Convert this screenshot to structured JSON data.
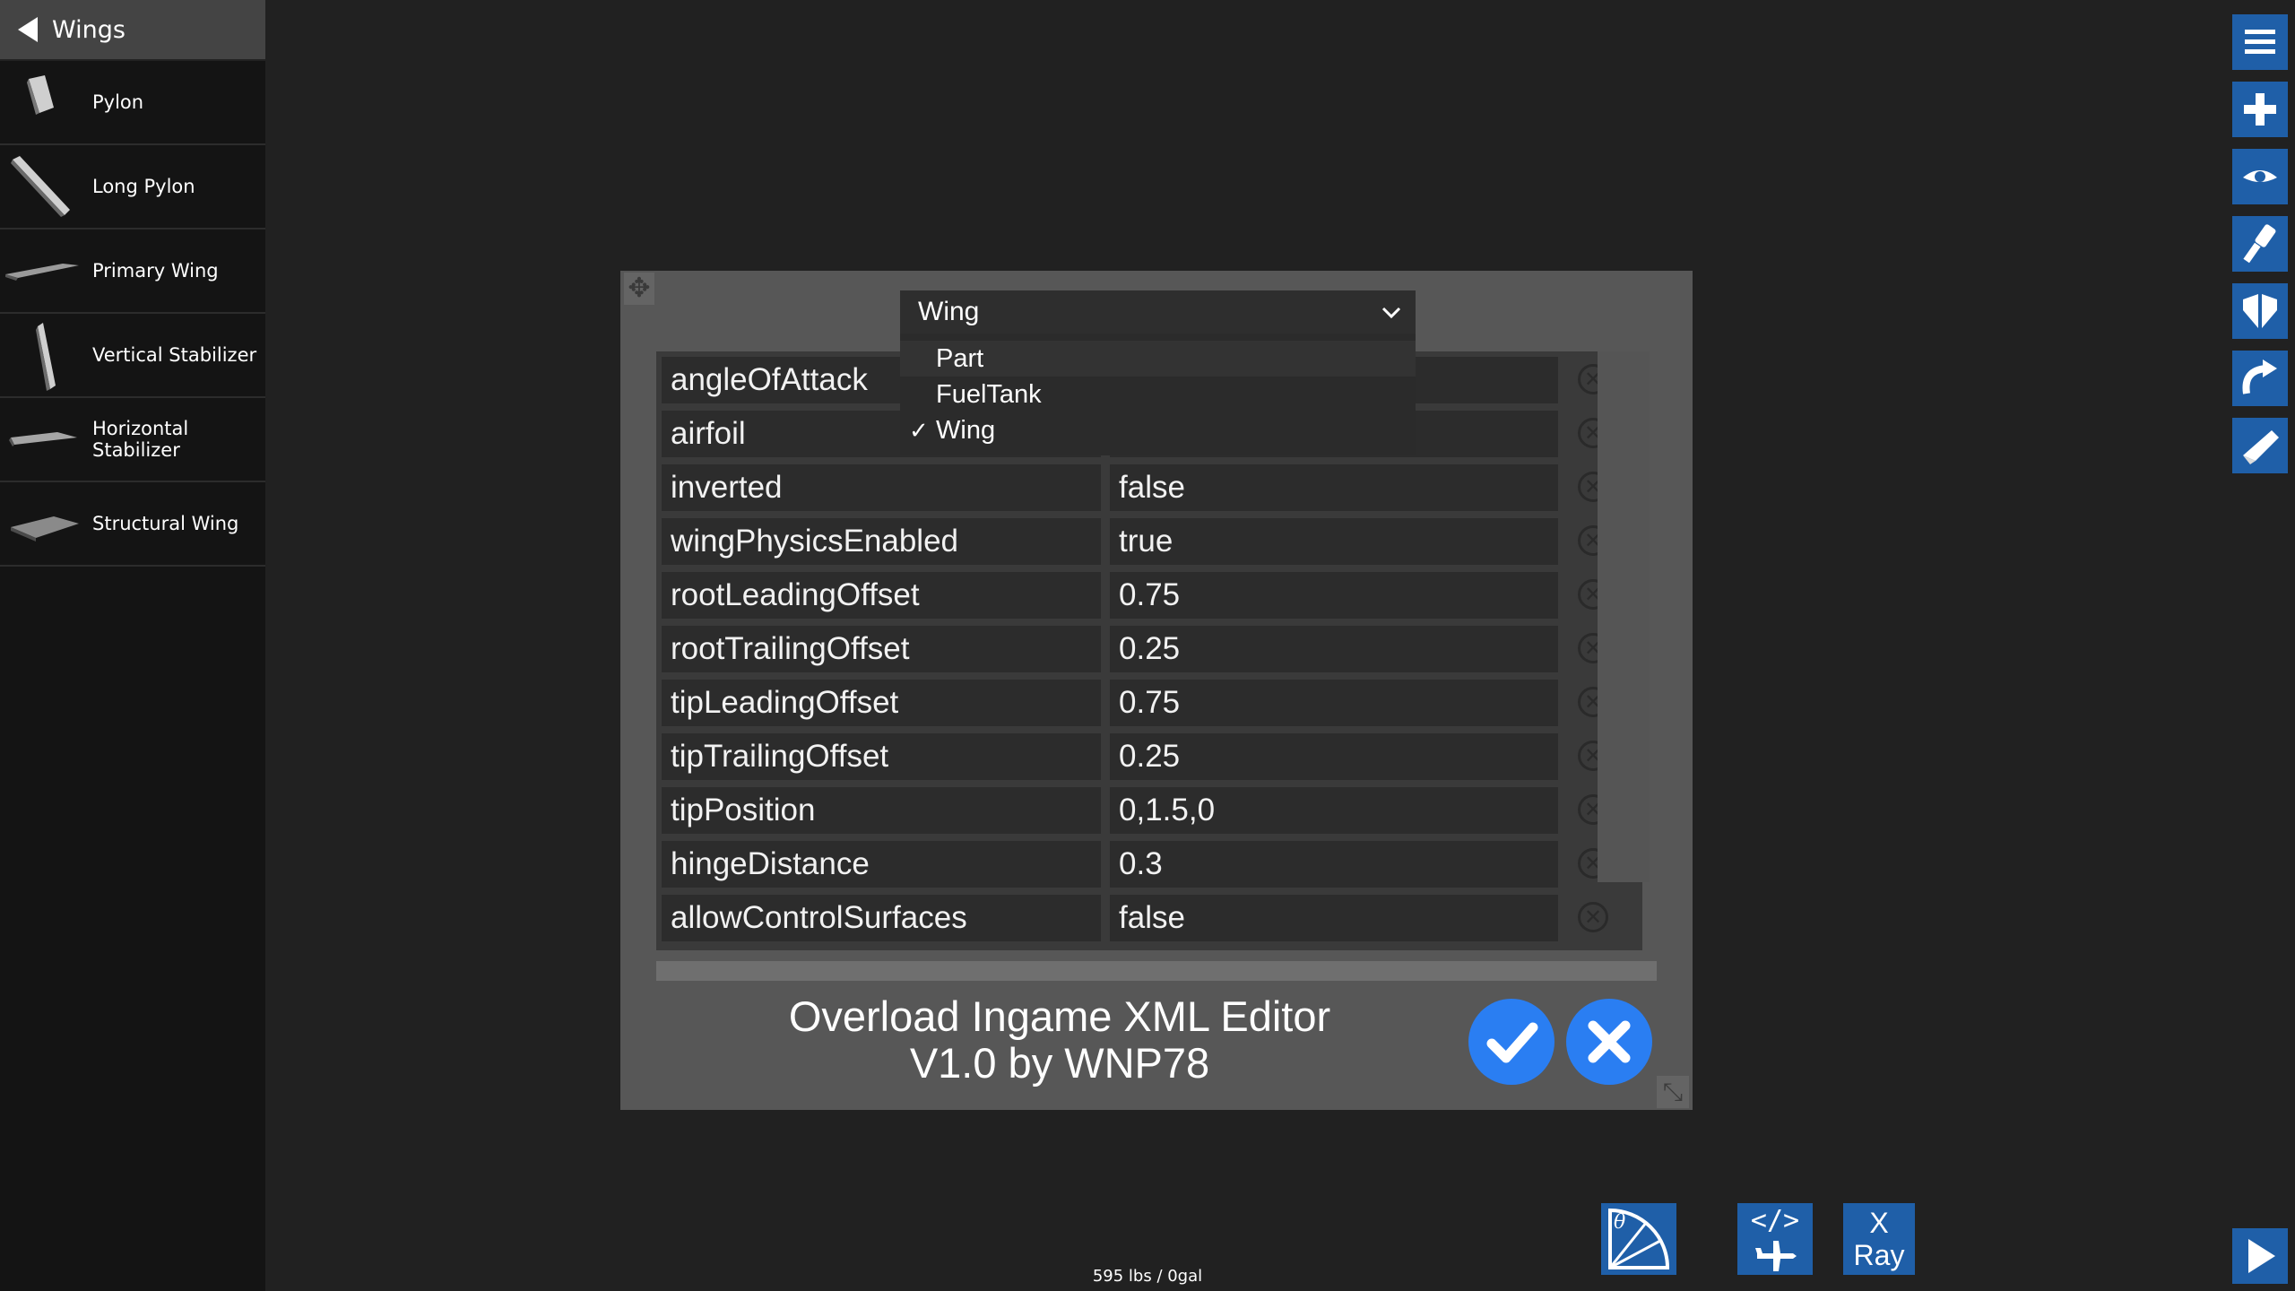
{
  "sidebar": {
    "title": "Wings",
    "items": [
      {
        "label": "Pylon"
      },
      {
        "label": "Long Pylon"
      },
      {
        "label": "Primary Wing"
      },
      {
        "label": "Vertical Stabilizer"
      },
      {
        "label": "Horizontal Stabilizer"
      },
      {
        "label": "Structural Wing"
      }
    ]
  },
  "editor": {
    "title_line1": "Overload Ingame XML Editor",
    "title_line2": "V1.0 by WNP78",
    "confirm_icon": "check-icon",
    "cancel_icon": "close-icon",
    "rows": [
      {
        "name": "angleOfAttack",
        "value": ""
      },
      {
        "name": "airfoil",
        "value": ""
      },
      {
        "name": "inverted",
        "value": "false"
      },
      {
        "name": "wingPhysicsEnabled",
        "value": "true"
      },
      {
        "name": "rootLeadingOffset",
        "value": "0.75"
      },
      {
        "name": "rootTrailingOffset",
        "value": "0.25"
      },
      {
        "name": "tipLeadingOffset",
        "value": "0.75"
      },
      {
        "name": "tipTrailingOffset",
        "value": "0.25"
      },
      {
        "name": "tipPosition",
        "value": "0,1.5,0"
      },
      {
        "name": "hingeDistance",
        "value": "0.3"
      },
      {
        "name": "allowControlSurfaces",
        "value": "false"
      }
    ],
    "dropdown": {
      "selected": "Wing",
      "options": [
        "Part",
        "FuelTank",
        "Wing"
      ]
    }
  },
  "toolbar_right": [
    "menu-icon",
    "add-icon",
    "eye-icon",
    "paint-icon",
    "symmetry-icon",
    "rotate-icon",
    "launch-icon"
  ],
  "bottom_bar": {
    "xray_line1": "X",
    "xray_line2": "Ray",
    "xml_label": "</>",
    "status": "595 lbs / 0gal"
  },
  "colors": {
    "background": "#212121",
    "sidebar": "#141414",
    "dialog": "#575757",
    "accent_blue": "#2a7ef2",
    "toolbar_blue": "#1f5fa8"
  }
}
